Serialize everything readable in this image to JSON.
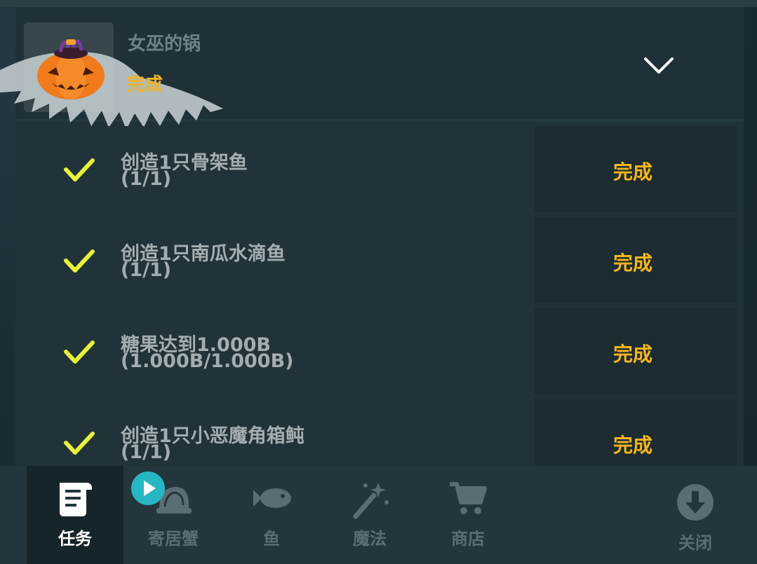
{
  "quest": {
    "title": "女巫的锅",
    "status": "完成"
  },
  "tasks": [
    {
      "line1": "创造1只骨架鱼",
      "line2": "(1/1)",
      "status": "完成"
    },
    {
      "line1": "创造1只南瓜水滴鱼",
      "line2": "(1/1)",
      "status": "完成"
    },
    {
      "line1": "糖果达到1.000B",
      "line2": "(1.000B/1.000B)",
      "status": "完成"
    },
    {
      "line1": "创造1只小恶魔角箱鲀",
      "line2": "(1/1)",
      "status": "完成"
    }
  ],
  "nav": {
    "tasks": "任务",
    "hermit_crab": "寄居蟹",
    "fish": "鱼",
    "magic": "魔法",
    "shop": "商店",
    "close": "关闭"
  },
  "colors": {
    "accent_gold": "#f6b51f",
    "check_yellow": "#e7f23a",
    "badge_teal": "#27b7c2"
  }
}
